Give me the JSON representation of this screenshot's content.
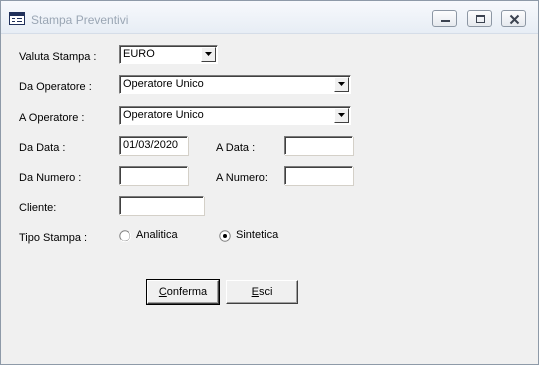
{
  "window": {
    "title": "Stampa Preventivi"
  },
  "form": {
    "valuta_label": "Valuta Stampa :",
    "valuta_value": "EURO",
    "da_operatore_label": "Da Operatore :",
    "da_operatore_value": "Operatore Unico",
    "a_operatore_label": "A Operatore :",
    "a_operatore_value": "Operatore Unico",
    "da_data_label": "Da Data :",
    "da_data_value": "01/03/2020",
    "a_data_label": "A Data :",
    "a_data_value": "",
    "da_numero_label": "Da Numero :",
    "da_numero_value": "",
    "a_numero_label": "A Numero:",
    "a_numero_value": "",
    "cliente_label": "Cliente:",
    "cliente_value": "",
    "tipo_stampa_label": "Tipo Stampa :",
    "options": [
      {
        "label": "Analitica",
        "selected": false
      },
      {
        "label": "Sintetica",
        "selected": true
      }
    ]
  },
  "buttons": {
    "conferma_accel": "C",
    "conferma_rest": "onferma",
    "esci_accel": "E",
    "esci_rest": "sci"
  },
  "colors": {
    "window_bg": "#f0f0f0",
    "border": "#8e9aa8",
    "title_text": "#9aa6b4"
  },
  "icons": {
    "app": "form-window-icon",
    "minimize": "minimize-icon",
    "maximize": "maximize-icon",
    "close": "close-icon"
  }
}
